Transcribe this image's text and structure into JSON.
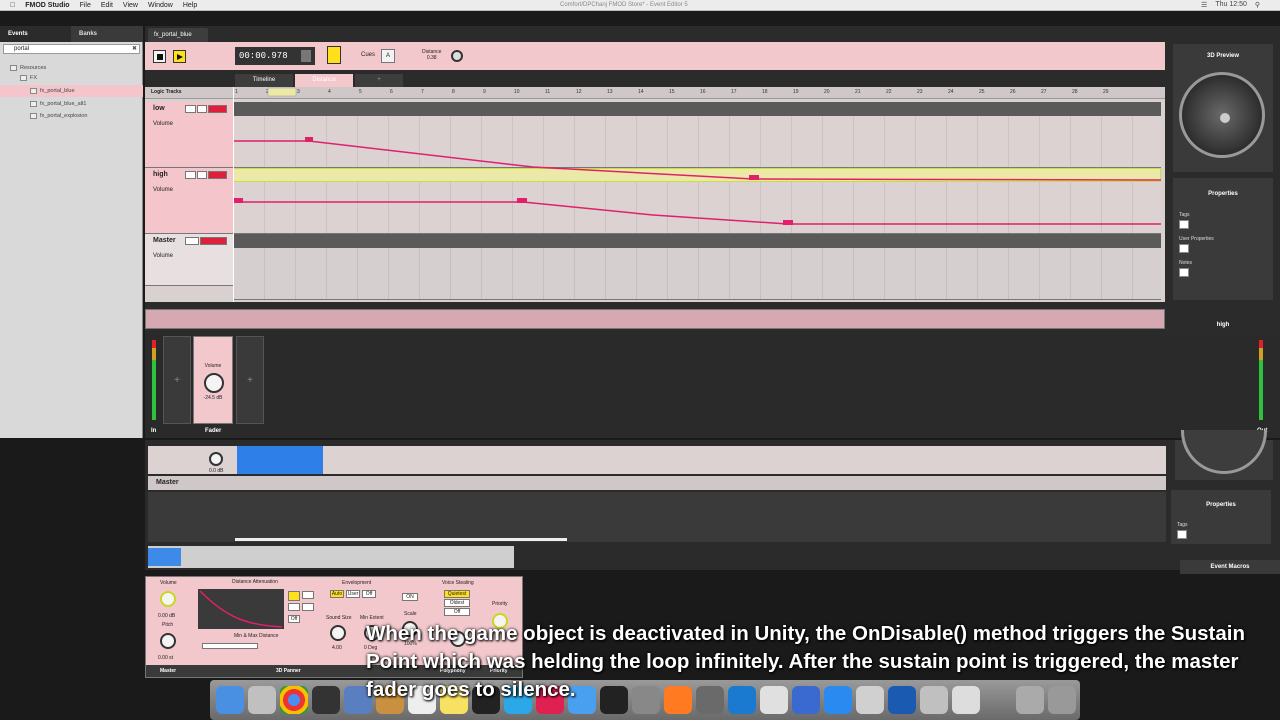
{
  "menubar": {
    "app": "FMOD Studio",
    "items": [
      "File",
      "Edit",
      "View",
      "Window",
      "Help"
    ],
    "window_title": "Comfort/DPChanj FMOD Store* - Event Editor 5",
    "clock": "Thu 12:50"
  },
  "browser": {
    "tabs": [
      "Events",
      "Banks"
    ],
    "search_value": "portal",
    "tree": [
      {
        "label": "Resources"
      },
      {
        "label": "FX"
      },
      {
        "label": "fx_portal_blue",
        "selected": true
      },
      {
        "label": "fx_portal_blue_alt1"
      },
      {
        "label": "fx_portal_explosion"
      }
    ]
  },
  "editor": {
    "event_tab": "fx_portal_blue",
    "time": "00:00.978",
    "cues_label": "Cues",
    "cue_value": "A",
    "distance_label": "Distance",
    "distance_value": "0.38",
    "tabs": [
      "Timeline",
      "Distance",
      "+"
    ],
    "logic_tracks_label": "Logic Tracks",
    "ruler": [
      "1",
      "2",
      "3",
      "4",
      "5",
      "6",
      "7",
      "8",
      "9",
      "10",
      "11",
      "12",
      "13",
      "14",
      "15",
      "16",
      "17",
      "18",
      "19",
      "20",
      "21",
      "22",
      "23",
      "24",
      "25",
      "26",
      "27",
      "28",
      "29"
    ],
    "tracks": [
      {
        "name": "low",
        "param": "Volume"
      },
      {
        "name": "high",
        "param": "Volume"
      },
      {
        "name": "Master",
        "param": "Volume"
      }
    ]
  },
  "deck": {
    "fader_label": "Fader",
    "volume_label": "Volume",
    "volume_value": "-24.5 dB",
    "in_label": "In",
    "out_label": "Out",
    "right_title": "high"
  },
  "right_panels": {
    "preview_title": "3D Preview",
    "properties_title": "Properties",
    "tags": "Tags",
    "user_properties": "User Properties",
    "notes": "Notes"
  },
  "lower": {
    "master": "Master",
    "properties_title": "Properties",
    "tags": "Tags",
    "event_macros": "Event Macros",
    "knob_value": "0.0 dB"
  },
  "macros": {
    "volume": "Volume",
    "volume_value": "0.00 dB",
    "pitch": "Pitch",
    "pitch_value": "0.00 st",
    "distance_attenuation": "Distance Attenuation",
    "minmax": "Min & Max Distance",
    "envelopment": "Envelopment",
    "env_opts": [
      "Auto",
      "User",
      "Off"
    ],
    "sound_size": "Sound Size",
    "sound_size_value": "4.00",
    "min_extent": "Min Extent",
    "min_extent_value": "0 Deg",
    "scale": "Scale",
    "scale_value": "100%",
    "voice_stealing": "Voice Stealing",
    "vs_opts": [
      "Quietest",
      "Oldest",
      "Off"
    ],
    "on": "ON",
    "priority": "Priority",
    "polyphony": "Polyphony",
    "master": "Master",
    "panner": "3D Panner",
    "off": "Off"
  },
  "caption": "When the game object is deactivated in Unity, the OnDisable() method triggers the Sustain Point which was helding the loop infinitely. After the sustain point is triggered, the master fader goes to silence.",
  "colors": {
    "track_pink": "#f4c6cc",
    "accent_yellow": "#ffe01a",
    "automation_line": "#e0206a",
    "clip_blue": "#2f7fe8"
  }
}
